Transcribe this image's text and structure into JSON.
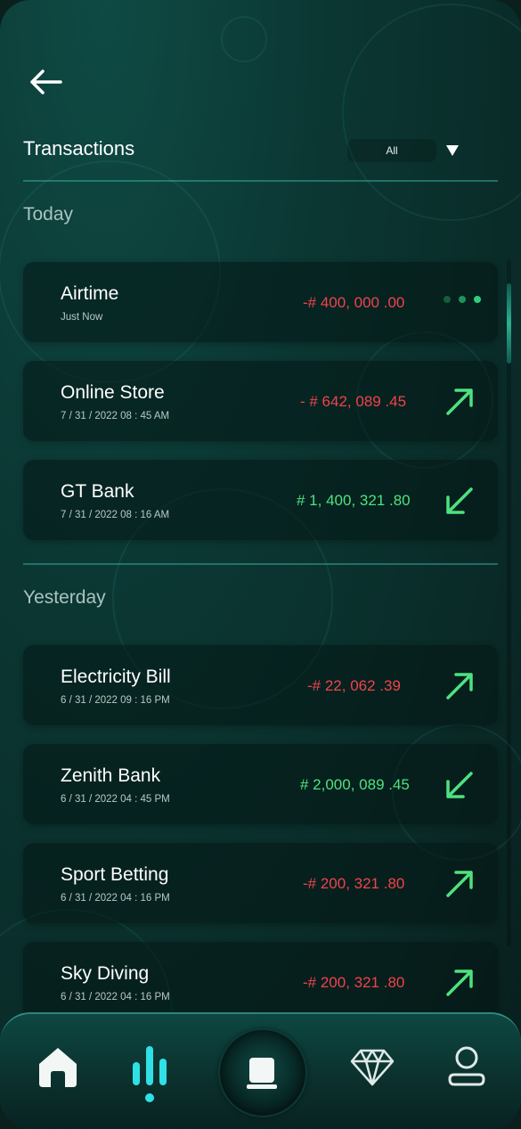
{
  "header": {
    "title": "Transactions",
    "filter_value": "All"
  },
  "sections": {
    "today": "Today",
    "yesterday": "Yesterday"
  },
  "transactions": [
    {
      "name": "Airtime",
      "date": "Just Now",
      "amount": "-# 400, 000 .00",
      "status": "pending"
    },
    {
      "name": "Online Store",
      "date": "7 / 31 / 2022  08 : 45 AM",
      "amount": "- # 642, 089 .45",
      "status": "outgoing"
    },
    {
      "name": "GT Bank",
      "date": "7 / 31 / 2022  08 : 16 AM",
      "amount": "# 1, 400, 321 .80",
      "status": "incoming"
    },
    {
      "name": "Electricity Bill",
      "date": "6 / 31 / 2022  09 : 16 PM",
      "amount": "-# 22, 062 .39",
      "status": "outgoing"
    },
    {
      "name": "Zenith Bank",
      "date": "6 / 31 / 2022  04 : 45 PM",
      "amount": "# 2,000, 089 .45",
      "status": "incoming"
    },
    {
      "name": "Sport Betting",
      "date": "6 / 31 / 2022  04 : 16 PM",
      "amount": "-# 200, 321 .80",
      "status": "outgoing"
    },
    {
      "name": "Sky Diving",
      "date": "6 / 31 / 2022  04 : 16 PM",
      "amount": "-# 200, 321 .80",
      "status": "outgoing"
    }
  ],
  "nav": {
    "items": [
      {
        "icon": "home-icon"
      },
      {
        "icon": "stats-icon",
        "active": true
      },
      {
        "icon": "wallet-icon"
      },
      {
        "icon": "diamond-icon"
      },
      {
        "icon": "profile-icon"
      }
    ]
  },
  "colors": {
    "negative": "#f0434b",
    "positive": "#4ee27f",
    "accent": "#2fe0e6",
    "background": "#0b3632"
  }
}
